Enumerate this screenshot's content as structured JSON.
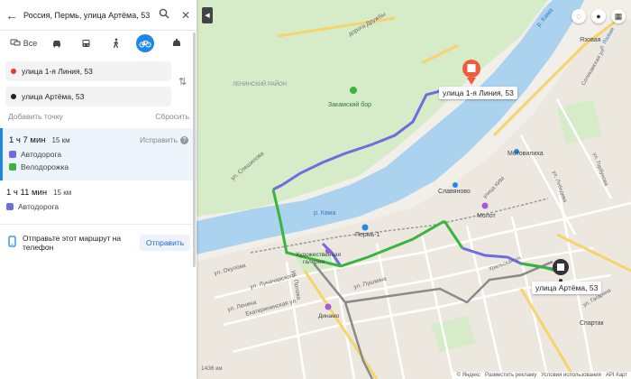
{
  "search": {
    "query": "Россия, Пермь, улица Артёма, 53"
  },
  "modes": {
    "all_label": "Все"
  },
  "route_points": {
    "from": "улица 1-я Линия, 53",
    "to": "улица Артёма, 53"
  },
  "actions": {
    "add_point": "Добавить точку",
    "reset": "Сбросить"
  },
  "routes": [
    {
      "time": "1 ч 7 мин",
      "distance": "15 км",
      "fix_label": "Исправить",
      "fix_icon": "?",
      "segments": [
        {
          "label": "Автодорога",
          "color": "#6b6de0"
        },
        {
          "label": "Велодорожка",
          "color": "#3ab43a"
        }
      ]
    },
    {
      "time": "1 ч 11 мин",
      "distance": "15 км",
      "segments": [
        {
          "label": "Автодорога",
          "color": "#6b6de0"
        }
      ]
    }
  ],
  "phone": {
    "text": "Отправьте этот маршрут на телефон",
    "button": "Отправить"
  },
  "map": {
    "callout_start": "улица 1-я Линия, 53",
    "callout_end": "улица Артёма, 53",
    "labels": {
      "zakamsky": "Закамский бор",
      "leninsky": "ЛЕНИНСКИЙ РАЙОН",
      "road_druzhby": "дорога Дружбы",
      "river_kama": "р. Кама",
      "river_kama2": "р. Кама",
      "perm1": "Пермь-1",
      "slavyanovo": "Славяново",
      "motovilikha": "Мотовилиха",
      "molot": "Молот",
      "yazovaya": "Язовая",
      "spartak": "Спартак",
      "dinamo": "Динамо",
      "khudozh": "Художественная",
      "khudozh2": "галерея",
      "lenina": "ул. Ленина",
      "pushkina": "ул. Пушкина",
      "lunacharskogo": "ул. Луначарского",
      "ekaterininskaya": "Екатерининская ул.",
      "okulova": "ул. Окулова",
      "popova": "ул. Попова",
      "spesh": "ул. Спешилова",
      "artema": "ул. Артёма",
      "km": "1436 км",
      "solikamskaya": "Соликамская ул.",
      "pr_yazovaya": "р. Язовая",
      "ulica_kim": "улица КИМ",
      "uralskaya": "Уральская ул.",
      "lebedeva": "ул. Лебедева",
      "gorbunova": "ул. Горбунова",
      "gagarina": "ул. Гагарина"
    },
    "footer": {
      "brand": "© Яндекс",
      "ads": "Разместить рекламу",
      "terms": "Условия использования",
      "api": "API Карт"
    }
  }
}
